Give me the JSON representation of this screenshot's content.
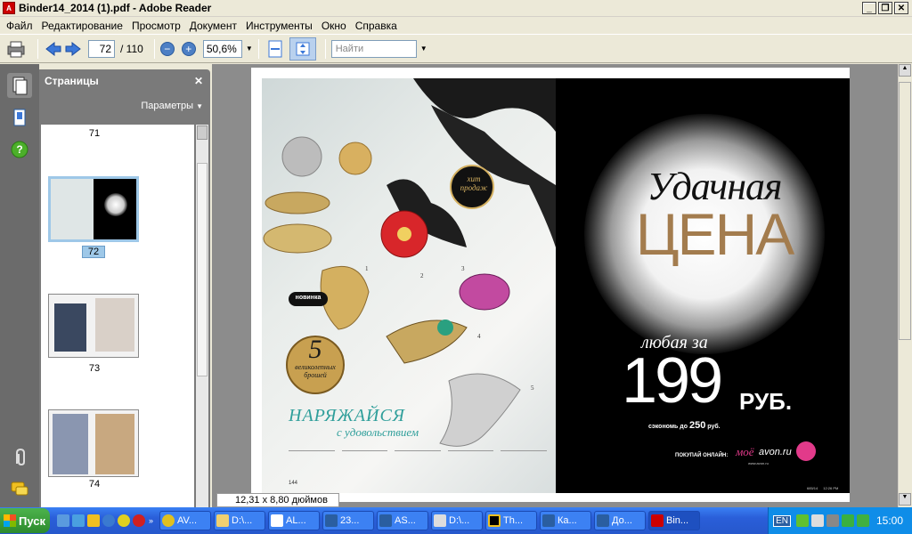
{
  "window": {
    "title": "Binder14_2014 (1).pdf - Adobe Reader"
  },
  "menu": [
    "Файл",
    "Редактирование",
    "Просмотр",
    "Документ",
    "Инструменты",
    "Окно",
    "Справка"
  ],
  "toolbar": {
    "page_value": "72",
    "page_total": "/ 110",
    "zoom_value": "50,6%",
    "find_placeholder": "Найти"
  },
  "panel": {
    "title": "Страницы",
    "options_label": "Параметры",
    "thumbnails": [
      "71",
      "72",
      "73",
      "74"
    ]
  },
  "status": {
    "page_size": "12,31 x 8,80 дюймов"
  },
  "left_page": {
    "badge_hit": "хит продаж",
    "badge_new": "новинка",
    "count_number": "5",
    "count_text": "великолепных брошей",
    "headline": "НАРЯЖАЙСЯ",
    "subline": "с удовольствием",
    "item_numbers": [
      "1",
      "2",
      "3",
      "4",
      "5"
    ],
    "page_number": "144"
  },
  "right_page": {
    "title_script": "Удачная",
    "title_big": "ЦЕНА",
    "any_for": "любая за",
    "price": "199",
    "currency": "РУБ.",
    "savings": "сэкономь до",
    "savings_value": "250",
    "savings_cur": "руб.",
    "online_label": "ПОКУПАЙ ОНЛАЙН:",
    "site_script": "моё",
    "site": "avon.ru",
    "site_url": "www.avon.ru",
    "footer_code": "685/14",
    "footer_time": "12:26 PM"
  },
  "taskbar": {
    "start": "Пуск",
    "tasks": [
      "AV...",
      "D:\\...",
      "AL...",
      "23...",
      "AS...",
      "D:\\...",
      "Th...",
      "Ка...",
      "До...",
      "Bin..."
    ],
    "lang": "EN",
    "clock": "15:00"
  },
  "colors": {
    "accent_blue": "#2658cc",
    "price_gold": "#b08a5a",
    "headline_teal": "#2e9e9a"
  }
}
